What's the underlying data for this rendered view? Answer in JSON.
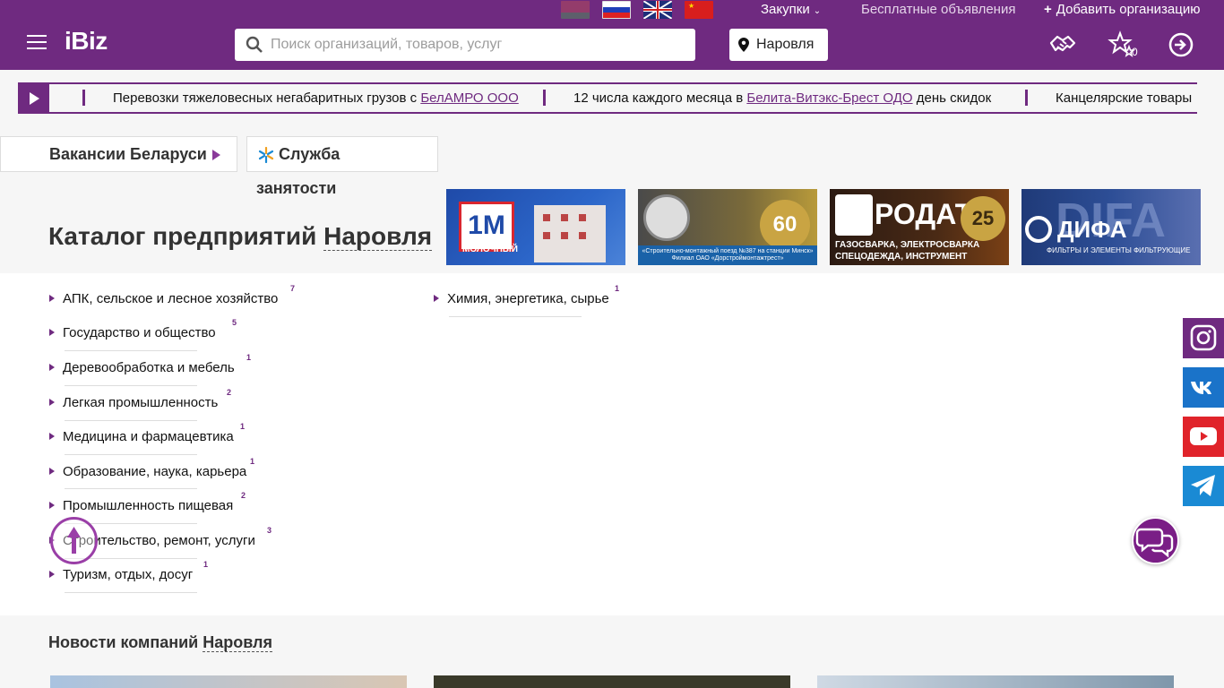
{
  "topbar": {
    "flags": [
      "by-flag",
      "ru-flag",
      "uk-flag",
      "cn-flag"
    ],
    "procurement": "Закупки",
    "free_ads": "Бесплатные объявления",
    "add_org": "Добавить организацию"
  },
  "header": {
    "logo": "iBiz",
    "search_placeholder": "Поиск организаций, товаров, услуг",
    "city": "Наровля",
    "favorites_count": "0"
  },
  "ticker": {
    "items": [
      {
        "text": "Перевозки тяжеловесных негабаритных грузов с ",
        "link": "БелАМРО ООО",
        "after": ""
      },
      {
        "text": "12 числа каждого месяца в ",
        "link": "Белита-Витэкс-Брест ОДО",
        "after": " день скидок"
      },
      {
        "text": "Канцелярские товары",
        "link": "",
        "after": ""
      }
    ]
  },
  "vacancies": {
    "label": "Вакансии Беларуси",
    "service_line1": "Служба",
    "service_line2": "занятости"
  },
  "catalog": {
    "title": "Каталог предприятий",
    "city": "Наровля"
  },
  "banners": [
    {
      "name": "1M",
      "caption": "МОЛОЧНЫЙ"
    },
    {
      "name": "60",
      "caption": "«Строительно-монтажный поезд №387 на станции Минск» Филиал ОАО «Дорстроймонтажтрест»"
    },
    {
      "name": "РОДАТ",
      "badge": "25",
      "caption": "ГАЗОСВАРКА, ЭЛЕКТРОСВАРКА СПЕЦОДЕЖДА, ИНСТРУМЕНТ"
    },
    {
      "name": "ДИФА",
      "big": "DIFA",
      "caption": "ФИЛЬТРЫ И ЭЛЕМЕНТЫ ФИЛЬТРУЮЩИЕ"
    }
  ],
  "categories": [
    {
      "label": "АПК, сельское и лесное хозяйство",
      "count": "7"
    },
    {
      "label": "Государство и общество",
      "count": "5"
    },
    {
      "label": "Деревообработка и мебель",
      "count": "1"
    },
    {
      "label": "Легкая промышленность",
      "count": "2"
    },
    {
      "label": "Медицина и фармацевтика",
      "count": "1"
    },
    {
      "label": "Образование, наука, карьера",
      "count": "1"
    },
    {
      "label": "Промышленность пищевая",
      "count": "2"
    },
    {
      "label": "Строительство, ремонт, услуги",
      "count": "3"
    },
    {
      "label": "Туризм, отдых, досуг",
      "count": "1"
    },
    {
      "label": "Химия, энергетика, сырье",
      "count": "1"
    }
  ],
  "news": {
    "title": "Новости компаний",
    "city": "Наровля"
  },
  "colors": {
    "brand": "#6f2a80",
    "instagram": "#6f2a80",
    "vk": "#1a73c9",
    "youtube": "#e0232a",
    "telegram": "#1a8ad4"
  }
}
